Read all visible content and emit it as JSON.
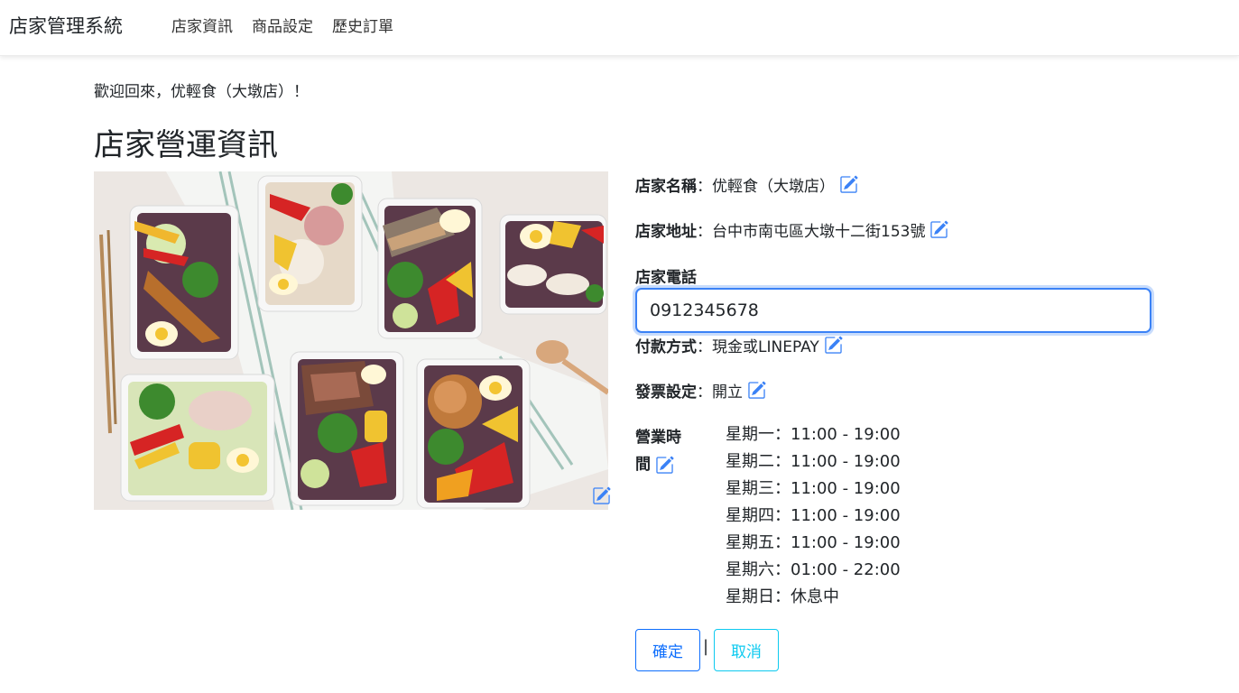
{
  "navbar": {
    "brand": "店家管理系統",
    "links": [
      "店家資訊",
      "商品設定",
      "歷史訂單"
    ]
  },
  "welcome": "歡迎回來，优輕食（大墩店）！",
  "page_title": "店家營運資訊",
  "store": {
    "name_label": "店家名稱",
    "name_value": "：优輕食（大墩店）",
    "address_label": "店家地址",
    "address_value": "：台中市南屯區大墩十二街153號",
    "phone_label": "店家電話",
    "phone_value": "0912345678",
    "payment_label": "付款方式",
    "payment_value": "：現金或LINEPAY",
    "invoice_label": "發票設定",
    "invoice_value": "：開立",
    "hours_label_line1": "營業時",
    "hours_label_line2": "間",
    "hours": [
      "星期一：11:00 - 19:00",
      "星期二：11:00 - 19:00",
      "星期三：11:00 - 19:00",
      "星期四：11:00 - 19:00",
      "星期五：11:00 - 19:00",
      "星期六：01:00 - 22:00",
      "星期日：休息中"
    ]
  },
  "buttons": {
    "confirm": "確定",
    "separator": "|",
    "cancel": "取消"
  },
  "colors": {
    "edit_icon": "#3b82f6",
    "focus_border": "#3b82f6",
    "confirm_button": "#0d6efd",
    "cancel_button": "#0dcaf0"
  },
  "icons": {
    "edit": "pencil-square-icon"
  }
}
